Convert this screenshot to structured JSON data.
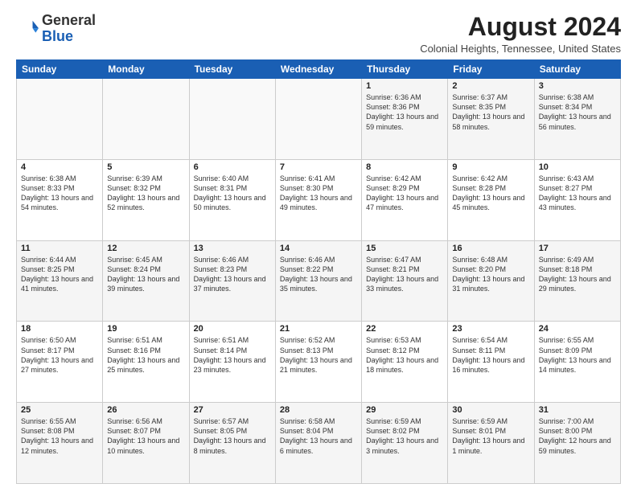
{
  "header": {
    "logo_general": "General",
    "logo_blue": "Blue",
    "month_year": "August 2024",
    "location": "Colonial Heights, Tennessee, United States"
  },
  "days_of_week": [
    "Sunday",
    "Monday",
    "Tuesday",
    "Wednesday",
    "Thursday",
    "Friday",
    "Saturday"
  ],
  "weeks": [
    [
      {
        "day": "",
        "info": ""
      },
      {
        "day": "",
        "info": ""
      },
      {
        "day": "",
        "info": ""
      },
      {
        "day": "",
        "info": ""
      },
      {
        "day": "1",
        "info": "Sunrise: 6:36 AM\nSunset: 8:36 PM\nDaylight: 13 hours and 59 minutes."
      },
      {
        "day": "2",
        "info": "Sunrise: 6:37 AM\nSunset: 8:35 PM\nDaylight: 13 hours and 58 minutes."
      },
      {
        "day": "3",
        "info": "Sunrise: 6:38 AM\nSunset: 8:34 PM\nDaylight: 13 hours and 56 minutes."
      }
    ],
    [
      {
        "day": "4",
        "info": "Sunrise: 6:38 AM\nSunset: 8:33 PM\nDaylight: 13 hours and 54 minutes."
      },
      {
        "day": "5",
        "info": "Sunrise: 6:39 AM\nSunset: 8:32 PM\nDaylight: 13 hours and 52 minutes."
      },
      {
        "day": "6",
        "info": "Sunrise: 6:40 AM\nSunset: 8:31 PM\nDaylight: 13 hours and 50 minutes."
      },
      {
        "day": "7",
        "info": "Sunrise: 6:41 AM\nSunset: 8:30 PM\nDaylight: 13 hours and 49 minutes."
      },
      {
        "day": "8",
        "info": "Sunrise: 6:42 AM\nSunset: 8:29 PM\nDaylight: 13 hours and 47 minutes."
      },
      {
        "day": "9",
        "info": "Sunrise: 6:42 AM\nSunset: 8:28 PM\nDaylight: 13 hours and 45 minutes."
      },
      {
        "day": "10",
        "info": "Sunrise: 6:43 AM\nSunset: 8:27 PM\nDaylight: 13 hours and 43 minutes."
      }
    ],
    [
      {
        "day": "11",
        "info": "Sunrise: 6:44 AM\nSunset: 8:25 PM\nDaylight: 13 hours and 41 minutes."
      },
      {
        "day": "12",
        "info": "Sunrise: 6:45 AM\nSunset: 8:24 PM\nDaylight: 13 hours and 39 minutes."
      },
      {
        "day": "13",
        "info": "Sunrise: 6:46 AM\nSunset: 8:23 PM\nDaylight: 13 hours and 37 minutes."
      },
      {
        "day": "14",
        "info": "Sunrise: 6:46 AM\nSunset: 8:22 PM\nDaylight: 13 hours and 35 minutes."
      },
      {
        "day": "15",
        "info": "Sunrise: 6:47 AM\nSunset: 8:21 PM\nDaylight: 13 hours and 33 minutes."
      },
      {
        "day": "16",
        "info": "Sunrise: 6:48 AM\nSunset: 8:20 PM\nDaylight: 13 hours and 31 minutes."
      },
      {
        "day": "17",
        "info": "Sunrise: 6:49 AM\nSunset: 8:18 PM\nDaylight: 13 hours and 29 minutes."
      }
    ],
    [
      {
        "day": "18",
        "info": "Sunrise: 6:50 AM\nSunset: 8:17 PM\nDaylight: 13 hours and 27 minutes."
      },
      {
        "day": "19",
        "info": "Sunrise: 6:51 AM\nSunset: 8:16 PM\nDaylight: 13 hours and 25 minutes."
      },
      {
        "day": "20",
        "info": "Sunrise: 6:51 AM\nSunset: 8:14 PM\nDaylight: 13 hours and 23 minutes."
      },
      {
        "day": "21",
        "info": "Sunrise: 6:52 AM\nSunset: 8:13 PM\nDaylight: 13 hours and 21 minutes."
      },
      {
        "day": "22",
        "info": "Sunrise: 6:53 AM\nSunset: 8:12 PM\nDaylight: 13 hours and 18 minutes."
      },
      {
        "day": "23",
        "info": "Sunrise: 6:54 AM\nSunset: 8:11 PM\nDaylight: 13 hours and 16 minutes."
      },
      {
        "day": "24",
        "info": "Sunrise: 6:55 AM\nSunset: 8:09 PM\nDaylight: 13 hours and 14 minutes."
      }
    ],
    [
      {
        "day": "25",
        "info": "Sunrise: 6:55 AM\nSunset: 8:08 PM\nDaylight: 13 hours and 12 minutes."
      },
      {
        "day": "26",
        "info": "Sunrise: 6:56 AM\nSunset: 8:07 PM\nDaylight: 13 hours and 10 minutes."
      },
      {
        "day": "27",
        "info": "Sunrise: 6:57 AM\nSunset: 8:05 PM\nDaylight: 13 hours and 8 minutes."
      },
      {
        "day": "28",
        "info": "Sunrise: 6:58 AM\nSunset: 8:04 PM\nDaylight: 13 hours and 6 minutes."
      },
      {
        "day": "29",
        "info": "Sunrise: 6:59 AM\nSunset: 8:02 PM\nDaylight: 13 hours and 3 minutes."
      },
      {
        "day": "30",
        "info": "Sunrise: 6:59 AM\nSunset: 8:01 PM\nDaylight: 13 hours and 1 minute."
      },
      {
        "day": "31",
        "info": "Sunrise: 7:00 AM\nSunset: 8:00 PM\nDaylight: 12 hours and 59 minutes."
      }
    ]
  ]
}
